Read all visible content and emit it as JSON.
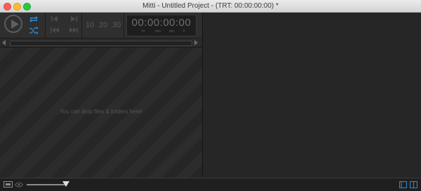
{
  "window": {
    "title": "Mitti - Untitled Project - (TRT: 00:00:00:00) *"
  },
  "transport": {
    "speeds": [
      "10",
      "20",
      "30"
    ],
    "timecode": "00:00:00:00",
    "timecode_labels": [
      "hr",
      "min",
      "sec",
      "fr"
    ]
  },
  "playlist": {
    "drop_hint": "You can drop files & folders here!"
  },
  "icons": {
    "play": "play-icon",
    "repeat": "repeat-icon",
    "shuffle": "shuffle-icon",
    "prev": "skip-previous-icon",
    "next": "skip-next-icon",
    "rewind": "rewind-icon",
    "fast_forward": "fast-forward-icon"
  },
  "colors": {
    "accent": "#2e8bd6",
    "close": "#fc5f57",
    "minimize": "#fdbc2e",
    "maximize": "#2ac940"
  },
  "bottom_bar": {
    "zoom_level": 0.9
  }
}
